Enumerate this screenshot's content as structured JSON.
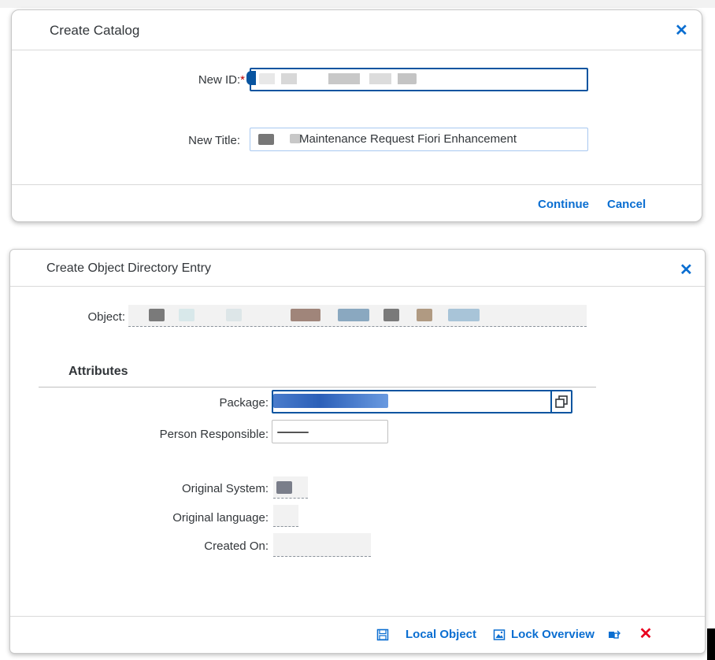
{
  "dialog1": {
    "title": "Create Catalog",
    "fields": {
      "new_id_label": "New ID:",
      "new_id_required": "*",
      "new_title_label": "New Title:",
      "new_title_value": "Maintenance Request Fiori Enhancement"
    },
    "buttons": {
      "continue": "Continue",
      "cancel": "Cancel"
    }
  },
  "dialog2": {
    "title": "Create Object Directory Entry",
    "object_label": "Object:",
    "section_attributes": "Attributes",
    "package_label": "Package:",
    "person_label": "Person Responsible:",
    "original_system_label": "Original System:",
    "original_language_label": "Original language:",
    "created_on_label": "Created On:",
    "buttons": {
      "local_object": "Local Object",
      "lock_overview": "Lock Overview"
    }
  },
  "colors": {
    "accent": "#0a6ed1",
    "danger": "#e9001f",
    "required": "#bb0000"
  },
  "icons": [
    "close-icon",
    "save-icon",
    "lock-overview-icon",
    "transport-icon",
    "cancel-x-icon",
    "value-help-icon"
  ]
}
